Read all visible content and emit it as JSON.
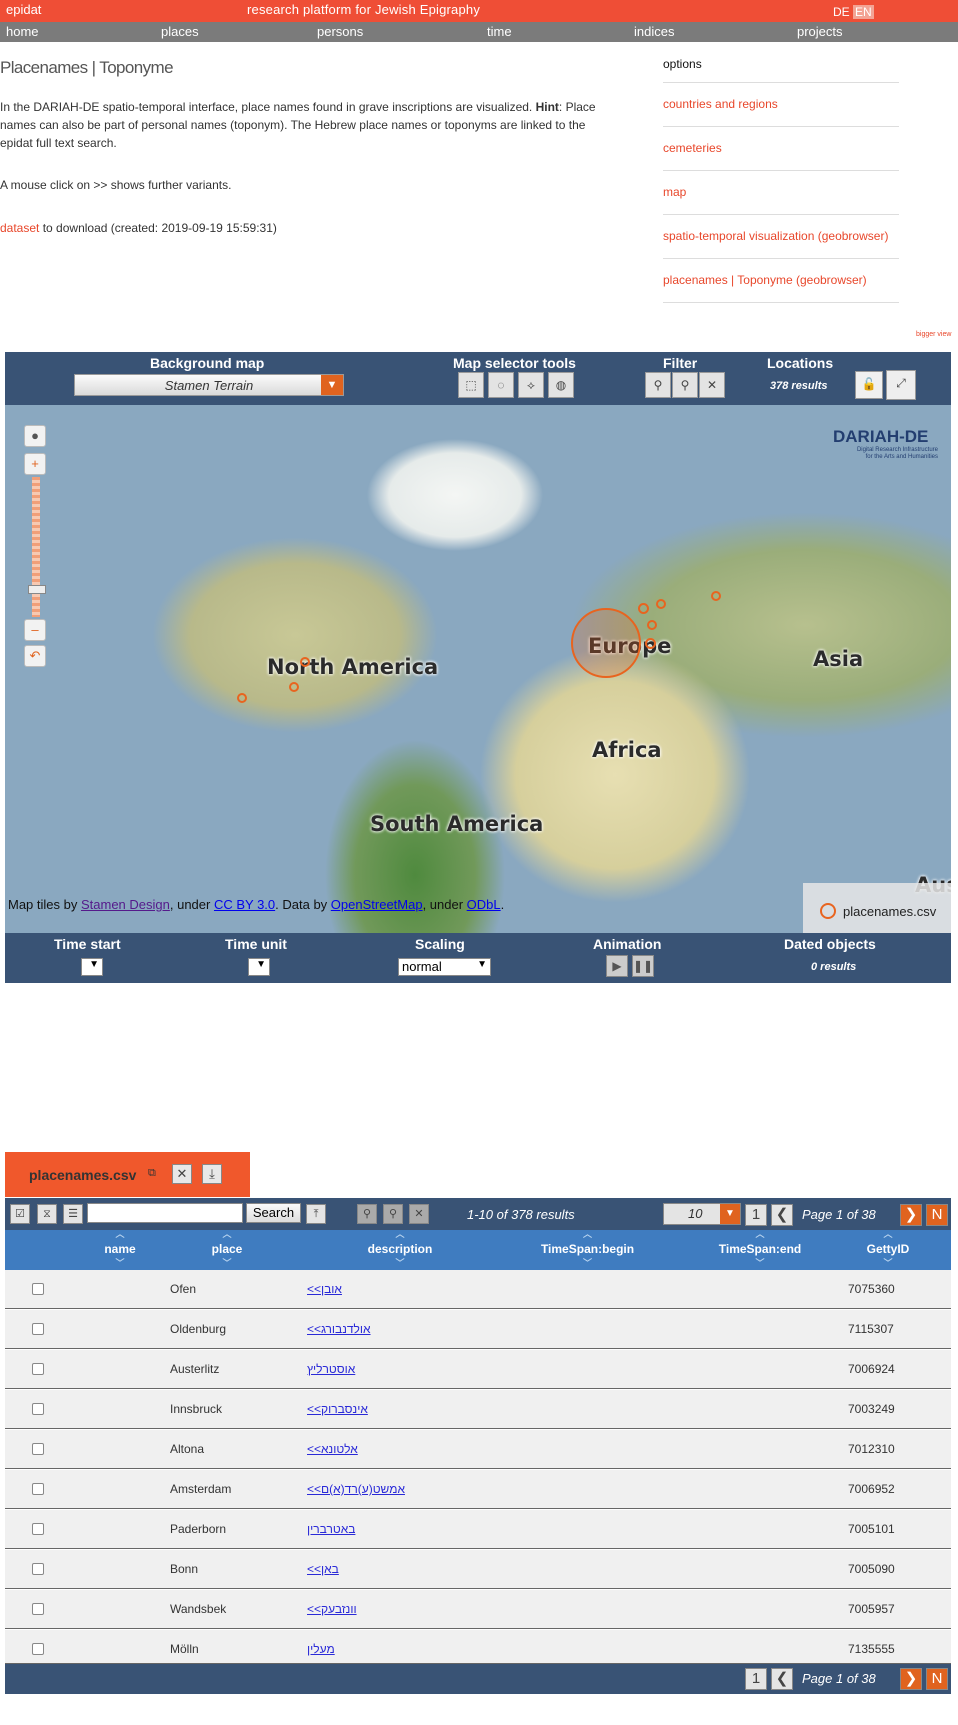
{
  "topbar": {
    "brand": "epidat",
    "tagline": "research  platform  for  Jewish  Epigraphy",
    "lang_de": "DE",
    "lang_en": "EN"
  },
  "nav": [
    "home",
    "places",
    "persons",
    "time",
    "indices",
    "projects"
  ],
  "page": {
    "title": "Placenames | Toponyme",
    "intro_1": "In the DARIAH-DE spatio-temporal interface, place names found in grave inscriptions are visualized. ",
    "hint_label": "Hint",
    "intro_2": ": Place names can also be part of personal names (toponym). The Hebrew place names or toponyms are linked to the epidat full text search.",
    "mouse_hint": "A mouse click on >> shows further variants.",
    "dataset_link": "dataset",
    "dataset_text": " to download (created: 2019-09-19 15:59:31)"
  },
  "options": {
    "heading": "options",
    "items": [
      "countries and regions",
      "cemeteries",
      "map",
      "spatio-temporal visualization (geobrowser)",
      "placenames | Toponyme (geobrowser)"
    ]
  },
  "bigger_view": "bigger view",
  "geo": {
    "background_map_label": "Background map",
    "background_map_value": "Stamen Terrain",
    "selector_tools_label": "Map selector tools",
    "filter_label": "Filter",
    "locations_label": "Locations",
    "locations_results": "378 results",
    "continents": [
      "North America",
      "Europe",
      "Asia",
      "Africa",
      "South America",
      "Aus"
    ],
    "logo_name": "DARIAH-DE",
    "logo_sub1": "Digital Research Infrastructure",
    "logo_sub2": "for the Arts and Humanities",
    "attribution": {
      "t1": "Map tiles by ",
      "l1": "Stamen Design",
      "t2": ", under ",
      "l2": "CC BY 3.0",
      "t3": ". Data by ",
      "l3": "OpenStreetMap",
      "t4": ", under ",
      "l4": "ODbL",
      "t5": "."
    },
    "legend_label": "placenames.csv",
    "time_start_label": "Time start",
    "time_unit_label": "Time unit",
    "scaling_label": "Scaling",
    "scaling_value": "normal",
    "animation_label": "Animation",
    "dated_objects_label": "Dated objects",
    "dated_objects_results": "0 results"
  },
  "table": {
    "tab_name": "placenames.csv",
    "search_button": "Search",
    "results_text": "1-10 of 378 results",
    "page_size": "10",
    "page_number": "1",
    "page_text": "Page 1 of 38",
    "last_button": "N",
    "columns": [
      "name",
      "place",
      "description",
      "TimeSpan:begin",
      "TimeSpan:end",
      "GettyID"
    ],
    "rows": [
      {
        "place": "Ofen",
        "description": "אובן>>",
        "gid": "7075360"
      },
      {
        "place": "Oldenburg",
        "description": "אולדנבורג>>",
        "gid": "7115307"
      },
      {
        "place": "Austerlitz",
        "description": "אוסטרליץ",
        "gid": "7006924"
      },
      {
        "place": "Innsbruck",
        "description": "אינסברוק>>",
        "gid": "7003249"
      },
      {
        "place": "Altona",
        "description": "אלטונא>>",
        "gid": "7012310"
      },
      {
        "place": "Amsterdam",
        "description": "אמשט(ע)רד(א)ם>>",
        "gid": "7006952"
      },
      {
        "place": "Paderborn",
        "description": "באטרברין",
        "gid": "7005101"
      },
      {
        "place": "Bonn",
        "description": "באן>>",
        "gid": "7005090"
      },
      {
        "place": "Wandsbek",
        "description": "וונזבעק>>",
        "gid": "7005957"
      },
      {
        "place": "Mölln",
        "description": "מעלין",
        "gid": "7135555"
      }
    ]
  }
}
